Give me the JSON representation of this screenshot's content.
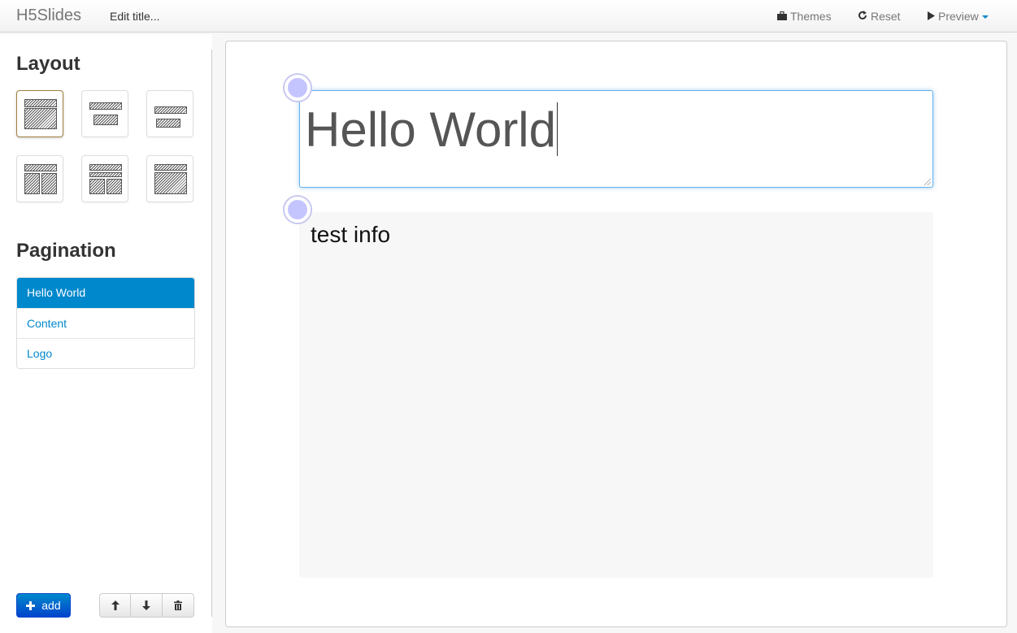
{
  "navbar": {
    "brand": "H5Slides",
    "edit_title": "Edit title...",
    "themes_label": "Themes",
    "themes_icon": "briefcase-icon",
    "reset_label": "Reset",
    "reset_icon": "refresh-icon",
    "preview_label": "Preview",
    "preview_icon": "play-icon"
  },
  "sidebar": {
    "layout_heading": "Layout",
    "layouts": [
      {
        "name": "title-content",
        "active": true
      },
      {
        "name": "title-subtitle",
        "active": false
      },
      {
        "name": "title-subtitle-alt",
        "active": false
      },
      {
        "name": "title-two-columns",
        "active": false
      },
      {
        "name": "title-three-rows-two-columns",
        "active": false
      },
      {
        "name": "title-wide-content",
        "active": false
      }
    ],
    "pagination_heading": "Pagination",
    "pages": [
      {
        "label": "Hello World",
        "active": true
      },
      {
        "label": "Content",
        "active": false
      },
      {
        "label": "Logo",
        "active": false
      }
    ],
    "add_label": "add",
    "move_up_icon": "arrow-up-icon",
    "move_down_icon": "arrow-down-icon",
    "delete_icon": "trash-icon"
  },
  "slide": {
    "title_value": "Hello World",
    "content_value": "test info"
  },
  "colors": {
    "accent": "#0088cc",
    "handle": "#c4c4ff",
    "focus_border": "#66afe9"
  }
}
